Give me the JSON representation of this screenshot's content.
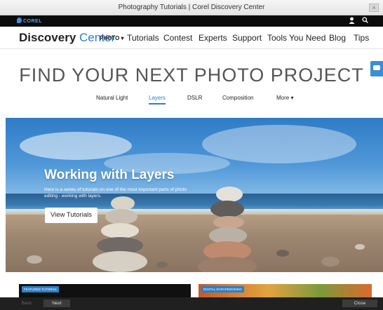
{
  "window": {
    "title": "Photography Tutorials | Corel Discovery Center",
    "close": "×"
  },
  "corelbar": {
    "logo": "COREL",
    "user_icon": "user-icon",
    "search_icon": "search-icon"
  },
  "navbar": {
    "brand_bold": "Discovery",
    "brand_light": "Center",
    "photo_menu": "PHOTO ▾",
    "links": [
      "Tutorials",
      "Contest",
      "Experts",
      "Support",
      "Tools You Need",
      "Blog",
      "Tips"
    ]
  },
  "hero_title": "FIND YOUR NEXT PHOTO PROJECT",
  "tabs": {
    "items": [
      "Natural Light",
      "Layers",
      "DSLR",
      "Composition",
      "More ▾"
    ],
    "active": "Layers"
  },
  "hero": {
    "heading": "Working with Layers",
    "subtitle": "Here is a series of tutorials on one of the most important parts of photo editing - working with layers.",
    "button": "View Tutorials"
  },
  "cards": [
    {
      "label": "FEATURED TUTORIAL"
    },
    {
      "label": "DIGITAL SCRAPBOOKING"
    }
  ],
  "bottombar": {
    "back": "Back",
    "next": "Next",
    "close": "Close"
  },
  "colors": {
    "accent": "#2e7fc4",
    "corel_bar": "#0b0b0b",
    "bottom_bar": "#202020"
  }
}
